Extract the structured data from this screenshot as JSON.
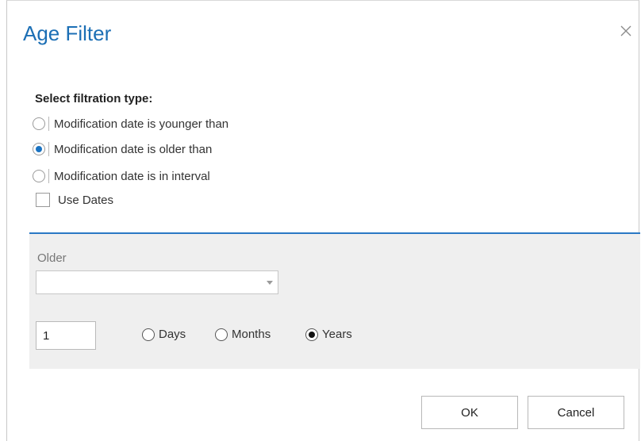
{
  "dialog": {
    "title": "Age Filter",
    "close_icon": "close-icon"
  },
  "filtration": {
    "label": "Select filtration type:",
    "options": [
      {
        "label": "Modification date is younger than",
        "checked": false
      },
      {
        "label": "Modification date is older than",
        "checked": true
      },
      {
        "label": "Modification date is in interval",
        "checked": false
      }
    ]
  },
  "use_dates": {
    "label": "Use Dates",
    "checked": false
  },
  "older": {
    "label": "Older",
    "select_value": "",
    "number_value": "1",
    "units": [
      {
        "label": "Days",
        "checked": false
      },
      {
        "label": "Months",
        "checked": false
      },
      {
        "label": "Years",
        "checked": true
      }
    ]
  },
  "buttons": {
    "ok": "OK",
    "cancel": "Cancel"
  },
  "colors": {
    "title": "#1c6fb5",
    "accent_line": "#2a78c4",
    "panel_bg": "#efefef"
  }
}
